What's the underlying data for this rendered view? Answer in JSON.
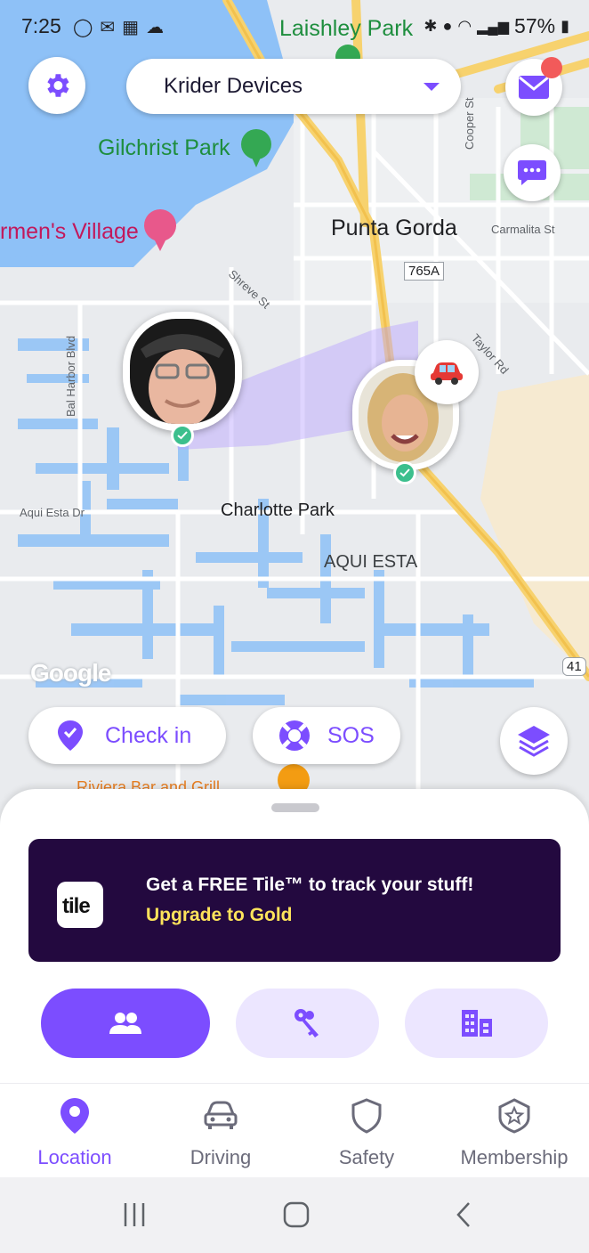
{
  "status_bar": {
    "time": "7:25",
    "battery": "57%"
  },
  "map": {
    "labels": {
      "laishley_park": "Laishley Park",
      "gilchrist_park": "Gilchrist Park",
      "fishermens_village": "rmen's Village",
      "punta_gorda": "Punta Gorda",
      "carmalita_st": "Carmalita St",
      "route_765a": "765A",
      "shreve_st": "Shreve St",
      "cooper_st": "Cooper St",
      "taylor_rd": "Taylor Rd",
      "bal_harbor_blvd": "Bal Harbor Blvd",
      "aqui_esta_dr": "Aqui Esta Dr",
      "charlotte_park": "Charlotte Park",
      "aqui_esta": "AQUI ESTA",
      "route_41": "41",
      "riviera_bar": "Riviera Bar and Grill",
      "google": "Google"
    }
  },
  "top": {
    "circle_name": "Krider Devices"
  },
  "actions": {
    "checkin_label": "Check in",
    "sos_label": "SOS"
  },
  "promo": {
    "logo_text": "tile",
    "headline": "Get a FREE Tile™ to track your stuff!",
    "cta": "Upgrade to Gold"
  },
  "segments": {
    "people": "people-icon",
    "items": "keys-icon",
    "places": "buildings-icon"
  },
  "nav": {
    "items": [
      {
        "label": "Location",
        "icon": "location-pin-icon",
        "active": true
      },
      {
        "label": "Driving",
        "icon": "car-icon",
        "active": false
      },
      {
        "label": "Safety",
        "icon": "shield-icon",
        "active": false
      },
      {
        "label": "Membership",
        "icon": "star-shield-icon",
        "active": false
      }
    ]
  },
  "colors": {
    "accent": "#7c4dff",
    "accent_light": "#ece6ff",
    "promo_bg": "#23093f",
    "promo_cta": "#fde35b",
    "online_green": "#3cbf8d",
    "notification_red": "#f25a5a"
  }
}
